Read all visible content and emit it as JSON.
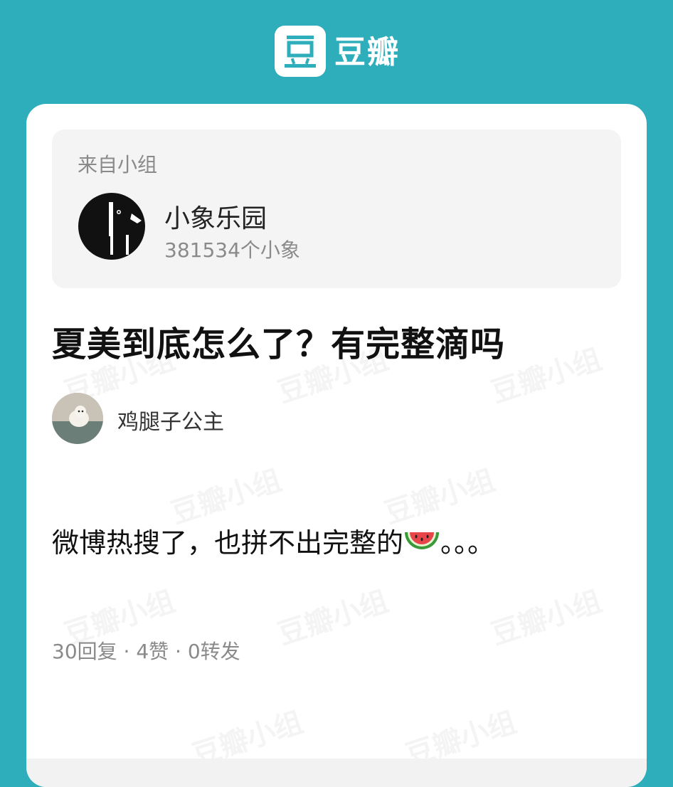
{
  "header": {
    "logo_glyph": "豆",
    "app_name": "豆瓣",
    "brand_color": "#2eaebb"
  },
  "group": {
    "from_label": "来自小组",
    "name": "小象乐园",
    "members": "381534个小象",
    "avatar_icon": "elephant-icon"
  },
  "post": {
    "title": "夏美到底怎么了？有完整滴吗",
    "author": "鸡腿子公主",
    "body_text": "微博热搜了，也拼不出完整的",
    "body_emoji": "watermelon-icon",
    "body_suffix": "。。。",
    "stats": "30回复 · 4赞 · 0转发"
  },
  "watermark": "豆瓣小组"
}
